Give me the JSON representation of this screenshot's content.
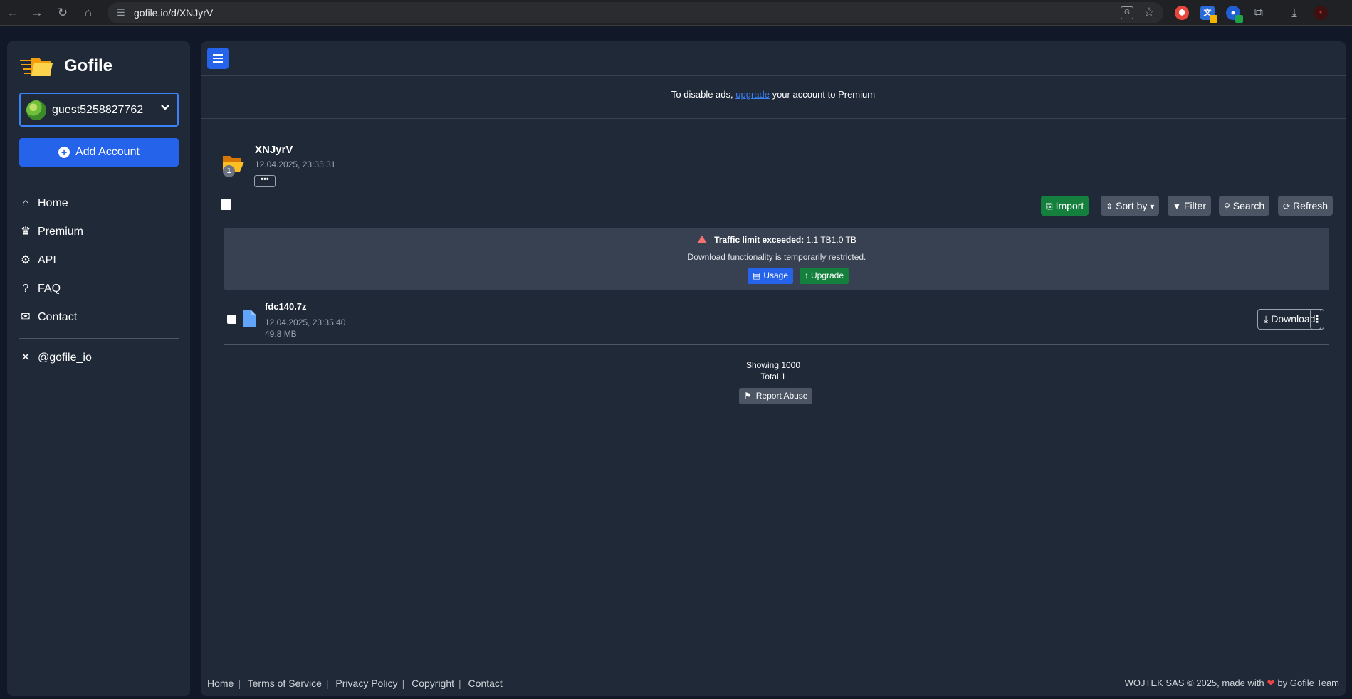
{
  "browser": {
    "url": "gofile.io/d/XNJyrV",
    "back_icon": "←",
    "forward_icon": "→",
    "reload_icon": "↻",
    "home_icon": "⌂"
  },
  "sidebar": {
    "brand": "Gofile",
    "account_name": "guest5258827762",
    "add_account_label": "Add Account",
    "nav": [
      {
        "label": "Home",
        "icon": "home-icon"
      },
      {
        "label": "Premium",
        "icon": "crown-icon"
      },
      {
        "label": "API",
        "icon": "cogs-icon"
      },
      {
        "label": "FAQ",
        "icon": "question-icon"
      },
      {
        "label": "Contact",
        "icon": "envelope-icon"
      }
    ],
    "social": {
      "label": "@gofile_io",
      "icon": "x-logo-icon"
    }
  },
  "ads": {
    "prefix": "To disable ads, ",
    "link": "upgrade",
    "suffix": " your account to Premium"
  },
  "folder": {
    "name": "XNJyrV",
    "date": "12.04.2025, 23:35:31",
    "count": "1",
    "more_label": "•••"
  },
  "toolbar": {
    "import_label": "Import",
    "sort_label": "Sort by",
    "filter_label": "Filter",
    "search_label": "Search",
    "refresh_label": "Refresh"
  },
  "alert": {
    "title": "Traffic limit exceeded:",
    "value": " 1.1 TB1.0 TB",
    "message": "Download functionality is temporarily restricted.",
    "usage_label": "Usage",
    "upgrade_label": "Upgrade"
  },
  "files": [
    {
      "name": "fdc140.7z",
      "date": "12.04.2025, 23:35:40",
      "size": "49.8 MB",
      "download_label": "Download"
    }
  ],
  "listing": {
    "showing": "Showing 1000",
    "total": "Total 1",
    "report_label": "Report Abuse"
  },
  "footer": {
    "links": [
      "Home",
      "Terms of Service",
      "Privacy Policy",
      "Copyright",
      "Contact"
    ],
    "credit_prefix": "WOJTEK SAS © 2025, made with",
    "credit_suffix": "by Gofile Team"
  },
  "colors": {
    "primary": "#2563eb",
    "success": "#15803d",
    "panel": "#1f2937",
    "background": "#111827"
  }
}
